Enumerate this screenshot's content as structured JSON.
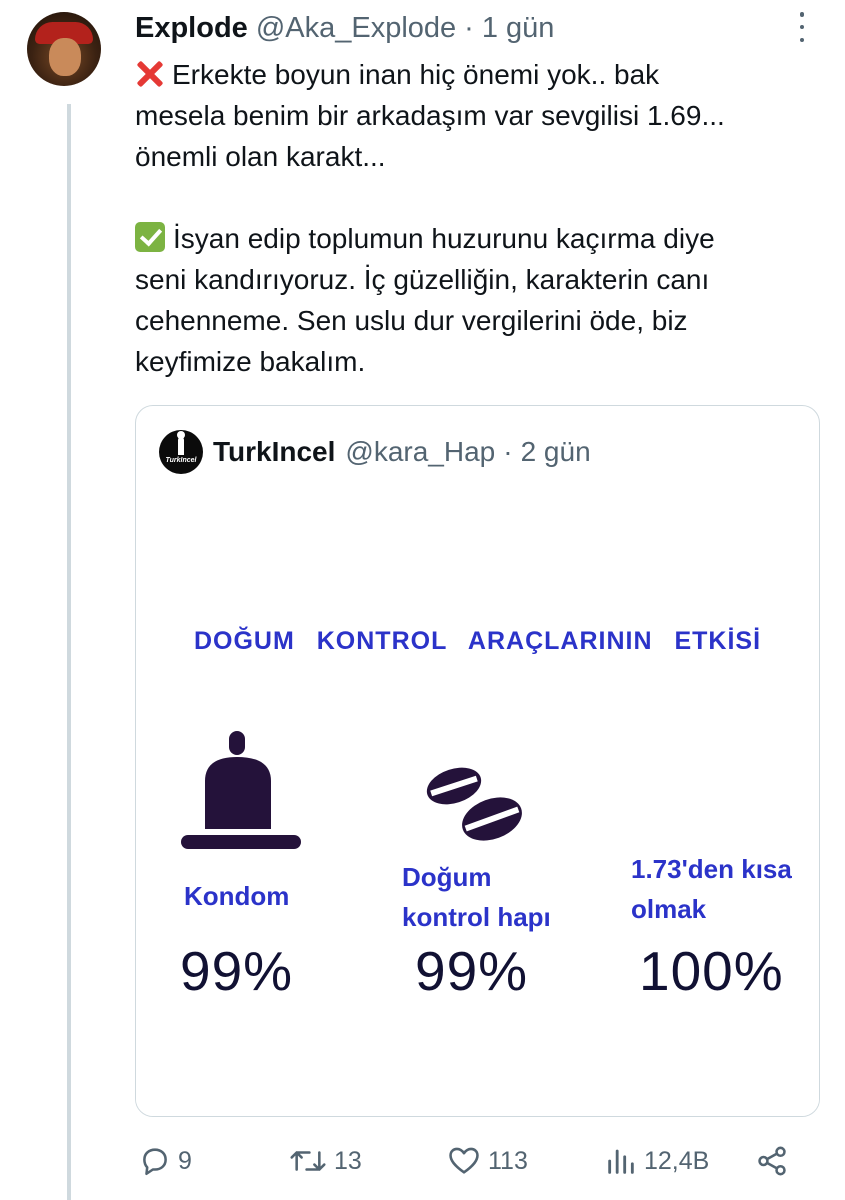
{
  "tweet": {
    "author_name": "Explode",
    "author_handle": "@Aka_Explode",
    "separator": "·",
    "time": "1 gün",
    "lines_1": [
      "Erkekte boyun inan hiç önemi yok.. bak",
      "mesela benim bir arkadaşım var sevgilisi 1.69...",
      "önemli olan karakt..."
    ],
    "lines_2": [
      "İsyan edip toplumun huzurunu kaçırma diye",
      "seni kandırıyoruz. İç güzelliğin, karakterin canı",
      "cehenneme. Sen uslu dur vergilerini öde, biz",
      "keyfimize bakalım."
    ]
  },
  "quote": {
    "author_name": "TurkIncel",
    "author_handle": "@kara_Hap",
    "separator": "·",
    "time": "2 gün",
    "avatar_text": "TurkIncel",
    "image": {
      "title": "DOĞUM KONTROL ARAÇLARININ ETKİSİ",
      "items": [
        {
          "label": "Kondom",
          "value": "99%",
          "icon": "condom-icon"
        },
        {
          "label_line1": "Doğum",
          "label_line2": "kontrol hapı",
          "value": "99%",
          "icon": "pills-icon"
        },
        {
          "label_line1": "1.73'den kısa",
          "label_line2": "olmak",
          "value": "100%"
        }
      ],
      "title_color": "#2b33c9"
    }
  },
  "actions": {
    "replies": "9",
    "retweets": "13",
    "likes": "113",
    "views": "12,4B"
  },
  "colors": {
    "text": "#0f1419",
    "secondary": "#536471",
    "border": "#cfd9de",
    "label_blue": "#2b33c9"
  }
}
